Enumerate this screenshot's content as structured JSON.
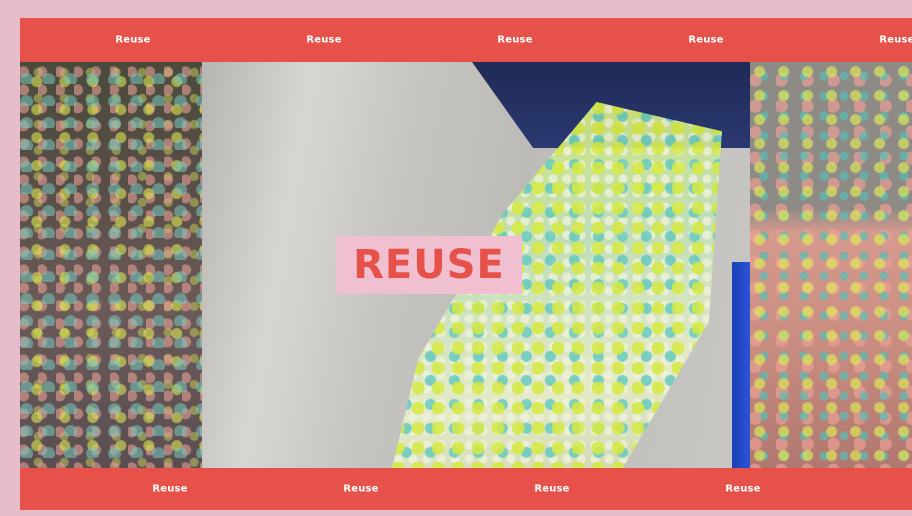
{
  "ticker_top": {
    "words": [
      "Reuse",
      "Reuse",
      "Reuse",
      "Reuse",
      "Reuse"
    ]
  },
  "ticker_bottom": {
    "words": [
      "Reuse",
      "Reuse",
      "Reuse",
      "Reuse"
    ]
  },
  "title": {
    "text": "REUSE"
  },
  "colors": {
    "banner": "#e6524a",
    "frame": "#e7bccb",
    "title_box": "#f0bfd0",
    "title_text": "#e6524a"
  }
}
